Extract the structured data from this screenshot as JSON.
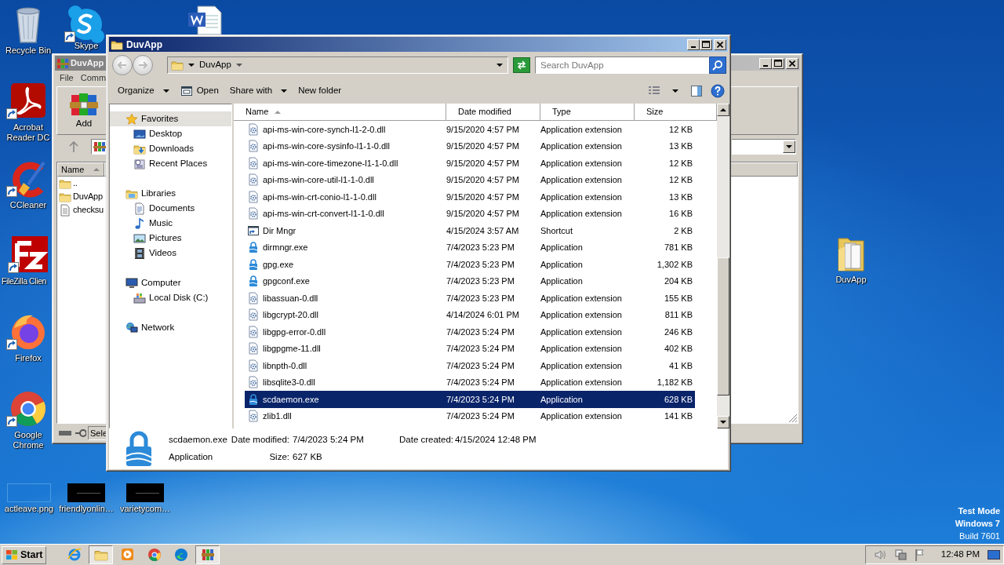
{
  "desktop_icons": [
    {
      "label": "Recycle Bin",
      "kind": "recycle",
      "shortcut": false
    },
    {
      "label": "Skype",
      "kind": "skype",
      "shortcut": true
    },
    {
      "kind": "word",
      "shortcut": false
    },
    {
      "label": "Acrobat Reader DC",
      "kind": "acrobat",
      "shortcut": true
    },
    {
      "label": "CCleaner",
      "kind": "ccleaner",
      "shortcut": true
    },
    {
      "label": "FileZilla Clien",
      "kind": "filezilla",
      "shortcut": true
    },
    {
      "label": "Firefox",
      "kind": "firefox",
      "shortcut": true
    },
    {
      "label": "Google Chrome",
      "kind": "chrome",
      "shortcut": true
    },
    {
      "label": "actleave.png",
      "kind": "blank-image",
      "shortcut": false
    },
    {
      "label": "friendlyonlin…",
      "kind": "dark-image",
      "shortcut": false
    },
    {
      "label": "varietycom…",
      "kind": "dark-image",
      "shortcut": false
    },
    {
      "label": "DuvApp",
      "kind": "folder",
      "shortcut": false
    }
  ],
  "back_window": {
    "title": "DuvApp",
    "active": false,
    "menu": [
      "File",
      "Comm"
    ],
    "toolbar": [
      {
        "label": "Add"
      }
    ],
    "columns": [
      {
        "label": "Name",
        "sorted": true
      }
    ],
    "rows": [
      {
        "name": "..",
        "kind": "folder"
      },
      {
        "name": "DuvApp",
        "kind": "folder"
      },
      {
        "name": "checksu",
        "kind": "file"
      }
    ],
    "status": "Sele"
  },
  "explorer": {
    "title": "DuvApp",
    "active": true,
    "breadcrumb": [
      "DuvApp"
    ],
    "search": {
      "placeholder": "Search DuvApp"
    },
    "commands": [
      {
        "label": "Organize",
        "kind": "plain",
        "dropdown": true
      },
      {
        "label": "Open",
        "kind": "open",
        "dropdown": false
      },
      {
        "label": "Share with",
        "kind": "plain",
        "dropdown": true
      },
      {
        "label": "New folder",
        "kind": "plain",
        "dropdown": false
      }
    ],
    "nav": [
      {
        "label": "Favorites",
        "kind": "star",
        "selected": true,
        "children": [
          {
            "label": "Desktop",
            "kind": "desktop",
            "selected": false
          },
          {
            "label": "Downloads",
            "kind": "downloads",
            "selected": false
          },
          {
            "label": "Recent Places",
            "kind": "recent",
            "selected": false
          }
        ]
      },
      {
        "label": "Libraries",
        "kind": "library",
        "selected": false,
        "children": [
          {
            "label": "Documents",
            "kind": "documents",
            "selected": false
          },
          {
            "label": "Music",
            "kind": "music",
            "selected": false
          },
          {
            "label": "Pictures",
            "kind": "pictures",
            "selected": false
          },
          {
            "label": "Videos",
            "kind": "videos",
            "selected": false
          }
        ]
      },
      {
        "label": "Computer",
        "kind": "computer",
        "selected": false,
        "children": [
          {
            "label": "Local Disk (C:)",
            "kind": "disk",
            "selected": false
          }
        ]
      },
      {
        "label": "Network",
        "kind": "network",
        "selected": false
      }
    ],
    "columns": [
      {
        "label": "Name",
        "sorted": true
      },
      {
        "label": "Date modified",
        "sorted": false
      },
      {
        "label": "Type",
        "sorted": false
      },
      {
        "label": "Size",
        "sorted": false
      }
    ],
    "rows": [
      {
        "name": "api-ms-win-core-synch-l1-2-0.dll",
        "kind": "dll",
        "date": "9/15/2020 4:57 PM",
        "type": "Application extension",
        "size": "12 KB",
        "selected": false
      },
      {
        "name": "api-ms-win-core-sysinfo-l1-1-0.dll",
        "kind": "dll",
        "date": "9/15/2020 4:57 PM",
        "type": "Application extension",
        "size": "13 KB",
        "selected": false
      },
      {
        "name": "api-ms-win-core-timezone-l1-1-0.dll",
        "kind": "dll",
        "date": "9/15/2020 4:57 PM",
        "type": "Application extension",
        "size": "12 KB",
        "selected": false
      },
      {
        "name": "api-ms-win-core-util-l1-1-0.dll",
        "kind": "dll",
        "date": "9/15/2020 4:57 PM",
        "type": "Application extension",
        "size": "12 KB",
        "selected": false
      },
      {
        "name": "api-ms-win-crt-conio-l1-1-0.dll",
        "kind": "dll",
        "date": "9/15/2020 4:57 PM",
        "type": "Application extension",
        "size": "13 KB",
        "selected": false
      },
      {
        "name": "api-ms-win-crt-convert-l1-1-0.dll",
        "kind": "dll",
        "date": "9/15/2020 4:57 PM",
        "type": "Application extension",
        "size": "16 KB",
        "selected": false
      },
      {
        "name": "Dir Mngr",
        "kind": "shortcut",
        "date": "4/15/2024 3:57 AM",
        "type": "Shortcut",
        "size": "2 KB",
        "selected": false
      },
      {
        "name": "dirmngr.exe",
        "kind": "exe",
        "date": "7/4/2023 5:23 PM",
        "type": "Application",
        "size": "781 KB",
        "selected": false
      },
      {
        "name": "gpg.exe",
        "kind": "exe",
        "date": "7/4/2023 5:23 PM",
        "type": "Application",
        "size": "1,302 KB",
        "selected": false
      },
      {
        "name": "gpgconf.exe",
        "kind": "exe",
        "date": "7/4/2023 5:23 PM",
        "type": "Application",
        "size": "204 KB",
        "selected": false
      },
      {
        "name": "libassuan-0.dll",
        "kind": "dll",
        "date": "7/4/2023 5:23 PM",
        "type": "Application extension",
        "size": "155 KB",
        "selected": false
      },
      {
        "name": "libgcrypt-20.dll",
        "kind": "dll",
        "date": "4/14/2024 6:01 PM",
        "type": "Application extension",
        "size": "811 KB",
        "selected": false
      },
      {
        "name": "libgpg-error-0.dll",
        "kind": "dll",
        "date": "7/4/2023 5:24 PM",
        "type": "Application extension",
        "size": "246 KB",
        "selected": false
      },
      {
        "name": "libgpgme-11.dll",
        "kind": "dll",
        "date": "7/4/2023 5:24 PM",
        "type": "Application extension",
        "size": "402 KB",
        "selected": false
      },
      {
        "name": "libnpth-0.dll",
        "kind": "dll",
        "date": "7/4/2023 5:24 PM",
        "type": "Application extension",
        "size": "41 KB",
        "selected": false
      },
      {
        "name": "libsqlite3-0.dll",
        "kind": "dll",
        "date": "7/4/2023 5:24 PM",
        "type": "Application extension",
        "size": "1,182 KB",
        "selected": false
      },
      {
        "name": "scdaemon.exe",
        "kind": "exe",
        "date": "7/4/2023 5:24 PM",
        "type": "Application",
        "size": "628 KB",
        "selected": true
      },
      {
        "name": "zlib1.dll",
        "kind": "dll",
        "date": "7/4/2023 5:24 PM",
        "type": "Application extension",
        "size": "141 KB",
        "selected": false
      }
    ],
    "details": {
      "kind": "exe",
      "name": "scdaemon.exe",
      "type": "Application",
      "properties": [
        {
          "label": "Date modified:",
          "value": "7/4/2023 5:24 PM"
        },
        {
          "label": "Date created:",
          "value": "4/15/2024 12:48 PM"
        },
        {
          "label": "Size:",
          "value": "627 KB"
        }
      ]
    }
  },
  "os_notice": [
    "Test Mode",
    "Windows 7",
    "Build 7601"
  ],
  "taskbar": {
    "start": "Start",
    "apps": [
      {
        "kind": "ie",
        "selected": false
      },
      {
        "kind": "explorer",
        "selected": true
      },
      {
        "kind": "media",
        "selected": false
      },
      {
        "kind": "chrome",
        "selected": false
      },
      {
        "kind": "edge",
        "selected": false
      },
      {
        "kind": "winrar",
        "selected": true
      }
    ],
    "clock": "12:48 PM"
  }
}
